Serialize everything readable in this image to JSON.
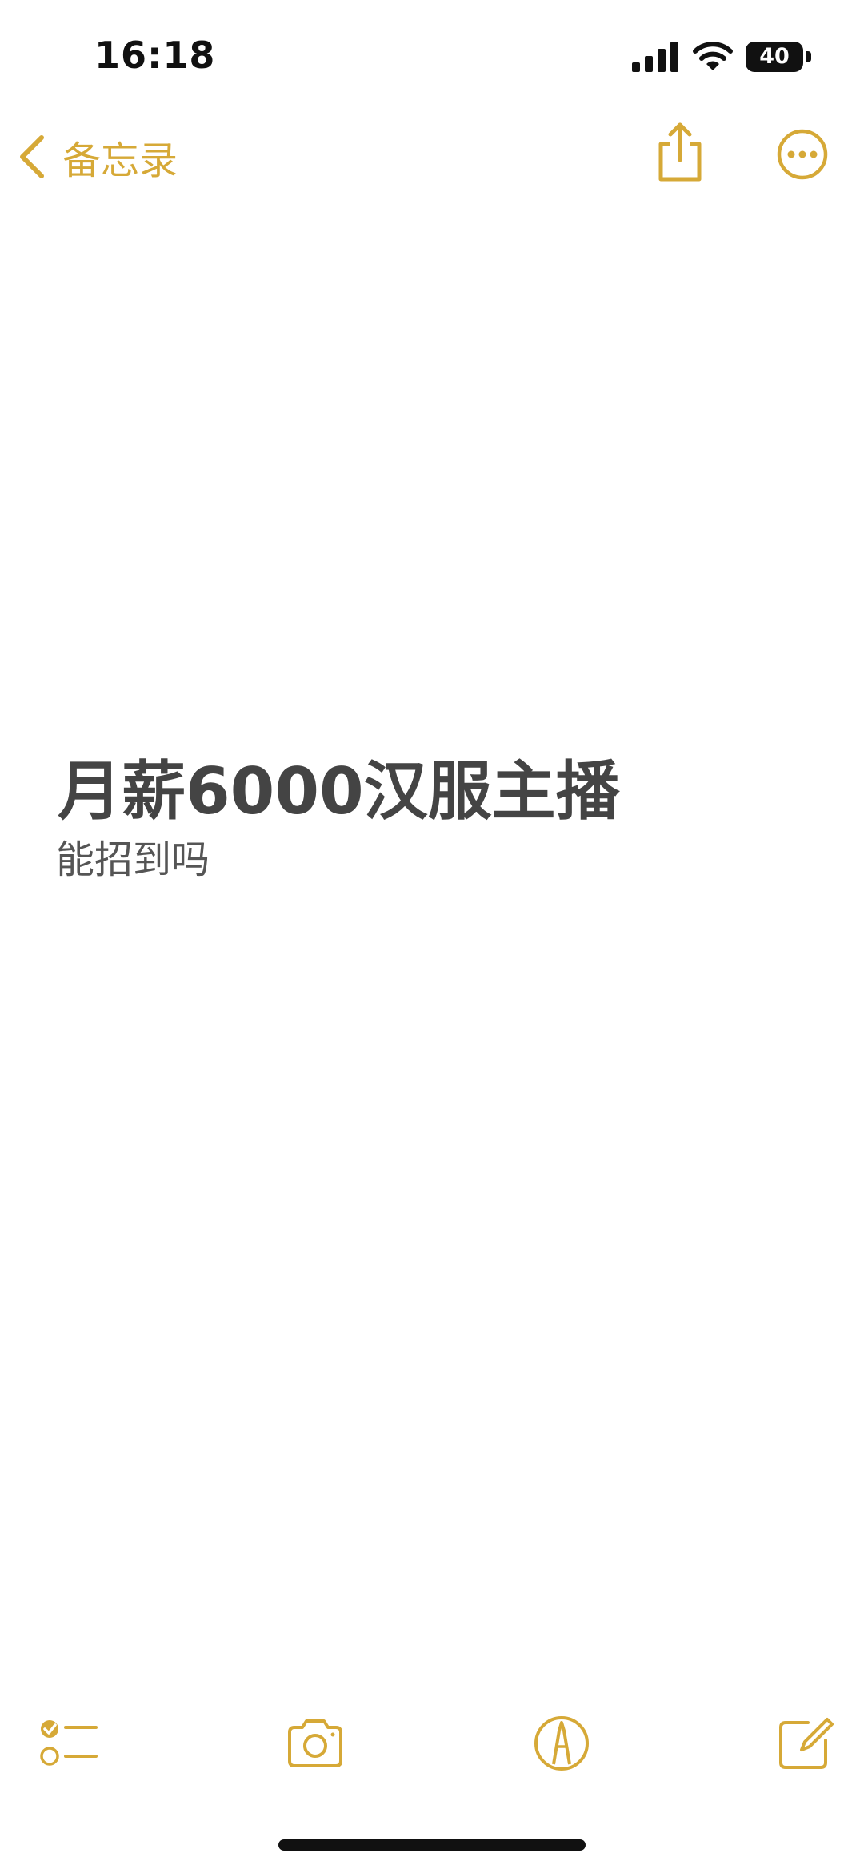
{
  "status_bar": {
    "time": "16:18",
    "battery_level": "40",
    "icons": [
      "signal-icon",
      "wifi-icon",
      "battery-icon"
    ]
  },
  "nav": {
    "back_label": "备忘录",
    "icons": [
      "chevron-left-icon",
      "share-icon",
      "more-icon"
    ]
  },
  "note": {
    "title": "月薪6000汉服主播",
    "body": "能招到吗"
  },
  "toolbar": {
    "icons": [
      "checklist-icon",
      "camera-icon",
      "markup-icon",
      "compose-icon"
    ]
  },
  "colors": {
    "accent": "#D6A937",
    "title_text": "#444444",
    "body_text": "#555555",
    "background": "#FFFFFF"
  }
}
